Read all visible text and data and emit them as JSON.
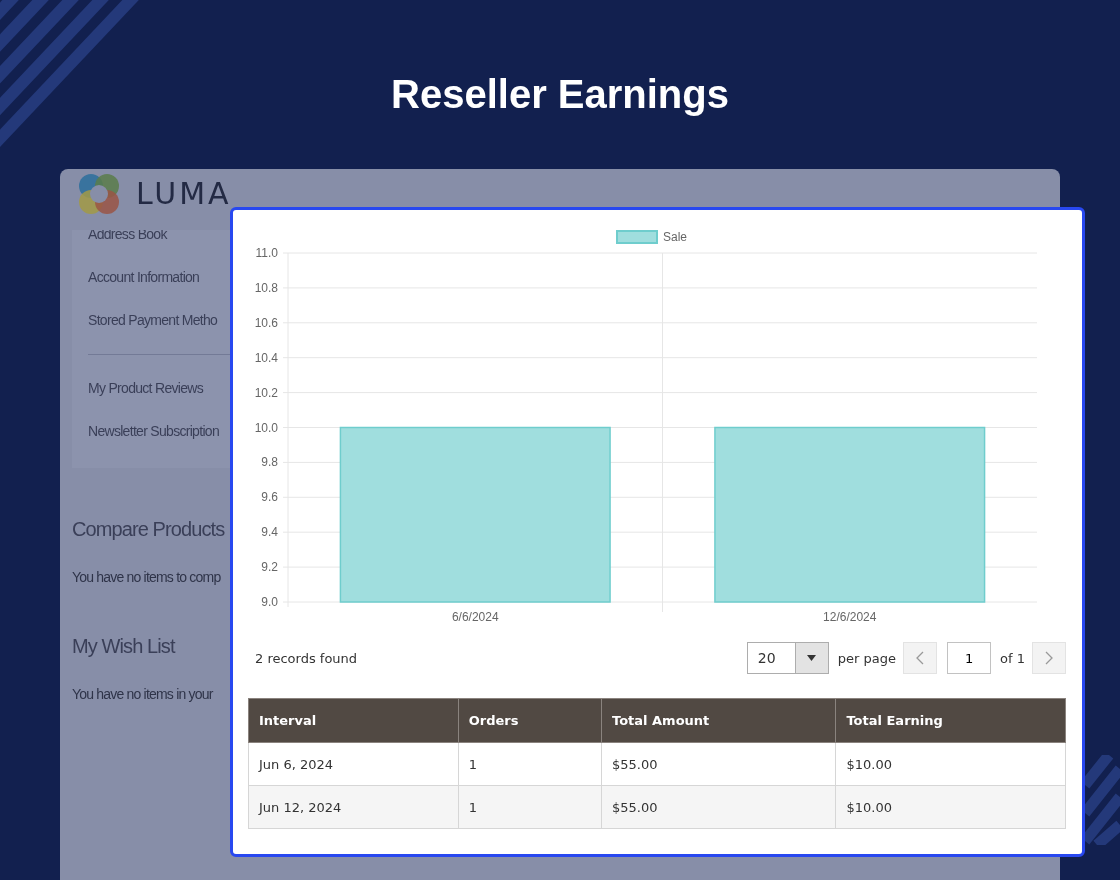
{
  "title": "Reseller Earnings",
  "store": {
    "logo_text": "LUMA",
    "account_nav": [
      {
        "label": "Address Book",
        "divider_before": false
      },
      {
        "label": "Account Information",
        "divider_before": false
      },
      {
        "label": "Stored Payment Metho",
        "divider_before": false
      },
      {
        "label": "My Product Reviews",
        "divider_before": true
      },
      {
        "label": "Newsletter Subscription",
        "divider_before": false
      }
    ],
    "sections": [
      {
        "heading": "Compare Products",
        "text": "You have no items to comp"
      },
      {
        "heading": "My Wish List",
        "text": "You have no items in your"
      }
    ]
  },
  "earnings": {
    "chart_data": {
      "type": "bar",
      "grid": true,
      "categories": [
        "6/6/2024",
        "12/6/2024"
      ],
      "series": [
        {
          "name": "Sale",
          "color": "#a0dede",
          "values": [
            10,
            10
          ]
        }
      ],
      "ylim": [
        9,
        11
      ],
      "yticks": [
        {
          "value": 9,
          "label": "9.0"
        },
        {
          "value": 9.2,
          "label": "9.2"
        },
        {
          "value": 9.4,
          "label": "9.4"
        },
        {
          "value": 9.6,
          "label": "9.6"
        },
        {
          "value": 9.8,
          "label": "9.8"
        },
        {
          "value": 10,
          "label": "10.0"
        },
        {
          "value": 10.2,
          "label": "10.2"
        },
        {
          "value": 10.4,
          "label": "10.4"
        },
        {
          "value": 10.6,
          "label": "10.6"
        },
        {
          "value": 10.8,
          "label": "10.8"
        },
        {
          "value": 11,
          "label": "11.0"
        }
      ]
    },
    "records_found": "2 records found",
    "pager": {
      "per_page_value": "20",
      "per_page_label": "per page",
      "page": "1",
      "of": "of 1"
    },
    "table": {
      "columns": [
        "Interval",
        "Orders",
        "Total Amount",
        "Total Earning"
      ],
      "rows": [
        [
          "Jun 6, 2024",
          "1",
          "$55.00",
          "$10.00"
        ],
        [
          "Jun 12, 2024",
          "1",
          "$55.00",
          "$10.00"
        ]
      ]
    }
  }
}
